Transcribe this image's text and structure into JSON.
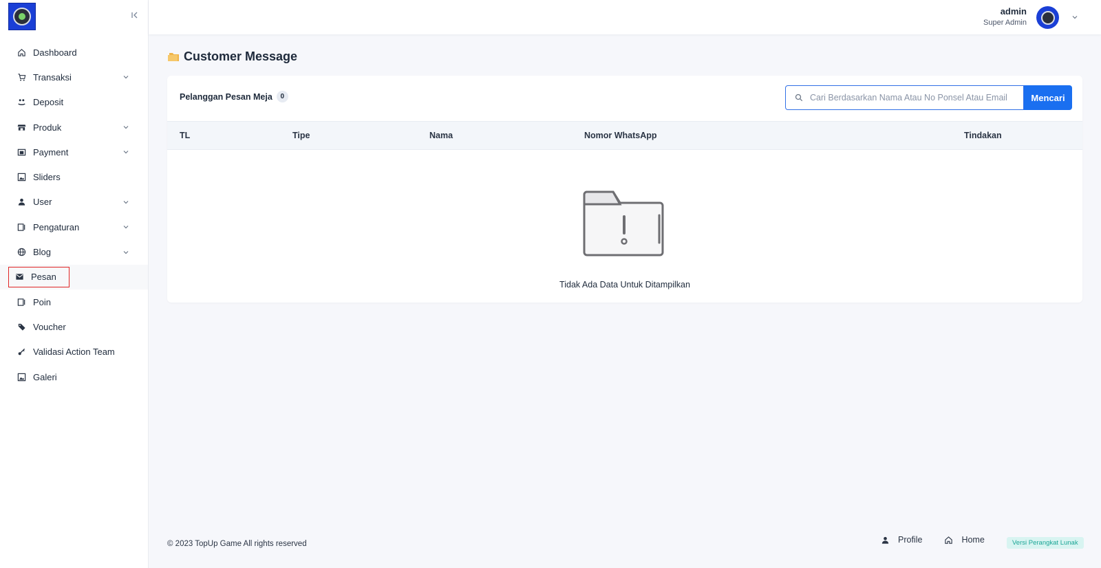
{
  "sidebar": {
    "items": [
      {
        "label": "Dashboard",
        "icon": "home-icon",
        "has_children": false
      },
      {
        "label": "Transaksi",
        "icon": "cart-icon",
        "has_children": true
      },
      {
        "label": "Deposit",
        "icon": "deposit-icon",
        "has_children": false
      },
      {
        "label": "Produk",
        "icon": "store-icon",
        "has_children": true
      },
      {
        "label": "Payment",
        "icon": "wallet-icon",
        "has_children": true
      },
      {
        "label": "Sliders",
        "icon": "image-icon",
        "has_children": false
      },
      {
        "label": "User",
        "icon": "user-icon",
        "has_children": true
      },
      {
        "label": "Pengaturan",
        "icon": "settings-panel-icon",
        "has_children": true
      },
      {
        "label": "Blog",
        "icon": "globe-icon",
        "has_children": true
      },
      {
        "label": "Pesan",
        "icon": "mail-icon",
        "has_children": false,
        "active": true
      },
      {
        "label": "Poin",
        "icon": "points-panel-icon",
        "has_children": false
      },
      {
        "label": "Voucher",
        "icon": "tag-icon",
        "has_children": false
      },
      {
        "label": "Validasi Action Team",
        "icon": "key-icon",
        "has_children": false
      },
      {
        "label": "Galeri",
        "icon": "gallery-icon",
        "has_children": false
      }
    ]
  },
  "header": {
    "user_name": "admin",
    "user_role": "Super Admin"
  },
  "page": {
    "title": "Customer Message"
  },
  "card": {
    "label": "Pelanggan Pesan Meja",
    "count": "0",
    "search_placeholder": "Cari Berdasarkan Nama Atau No Ponsel Atau Email",
    "search_button": "Mencari",
    "columns": [
      "TL",
      "Tipe",
      "Nama",
      "Nomor WhatsApp",
      "Tindakan"
    ],
    "empty_text": "Tidak Ada Data Untuk Ditampilkan"
  },
  "footer": {
    "copyright": "© 2023 TopUp Game All rights reserved",
    "links": [
      "Profile",
      "Home"
    ],
    "version_label": "Versi Perangkat Lunak"
  },
  "colors": {
    "primary": "#1a6ff0",
    "highlight": "#e02424",
    "badge_bg": "#d8f4f1",
    "badge_text": "#1ba596"
  }
}
